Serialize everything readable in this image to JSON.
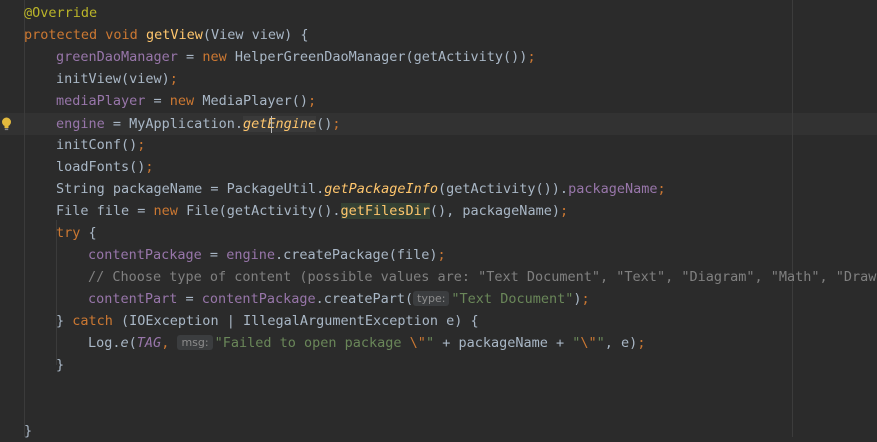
{
  "code": {
    "l1": {
      "annotation": "@Override"
    },
    "l2": {
      "kw1": "protected",
      "kw2": "void",
      "method": "getView",
      "params": "(View view) {"
    },
    "l3": {
      "field": "greenDaoManager",
      "eq": " = ",
      "kw": "new",
      "rest": " HelperGreenDaoManager(getActivity())",
      "semi": ";"
    },
    "l4": {
      "call": "initView(view)",
      "semi": ";"
    },
    "l5": {
      "field": "mediaPlayer",
      "eq": " = ",
      "kw": "new",
      "rest": " MediaPlayer()",
      "semi": ";"
    },
    "l6": {
      "field": "engine",
      "eq": " = MyApplication.",
      "static_call": "getEngine",
      "rest": "()",
      "semi": ";"
    },
    "l7": {
      "call": "initConf()",
      "semi": ";"
    },
    "l8": {
      "call": "loadFonts()",
      "semi": ";"
    },
    "l9": {
      "pre": "String packageName = PackageUtil.",
      "static_call": "getPackageInfo",
      "mid": "(getActivity()).",
      "field": "packageName",
      "semi": ";"
    },
    "l10": {
      "pre": "File file = ",
      "kw": "new",
      "mid": " File(getActivity().",
      "hl": "getFilesDir",
      "rest": "(), packageName)",
      "semi": ";"
    },
    "l11": {
      "kw": "try",
      "rest": " {"
    },
    "l12": {
      "field": "contentPackage",
      "eq": " = ",
      "field2": "engine",
      "rest": ".createPackage(file)",
      "semi": ";"
    },
    "l13": {
      "comment": "// Choose type of content (possible values are: \"Text Document\", \"Text\", \"Diagram\", \"Math\", \"Drawin"
    },
    "l14": {
      "field": "contentPart",
      "eq": " = ",
      "field2": "contentPackage",
      "rest": ".createPart(",
      "hint": "type:",
      "str": "\"Text Document\"",
      "close": ")",
      "semi": ";"
    },
    "l15": {
      "pre": "} ",
      "kw": "catch",
      "rest": " (IOException | IllegalArgumentException e) {"
    },
    "l16": {
      "pre": "Log.",
      "static_call": "e",
      "open": "(",
      "const": "TAG",
      "comma": ", ",
      "hint": "msg:",
      "str1": "\"Failed to open package ",
      "esc1": "\\\"",
      "str1end": "\"",
      "plus1": " + packageName + ",
      "str2": "\"",
      "esc2": "\\\"",
      "str2end": "\"",
      "end": ", e)",
      "semi": ";"
    },
    "l17": {
      "text": "}"
    },
    "l18": {
      "text": "}"
    }
  },
  "colors": {
    "background": "#2b2b2b",
    "keyword": "#cc7832",
    "method_decl": "#ffc66d",
    "field": "#9876aa",
    "string": "#6a8759",
    "comment": "#808080",
    "annotation": "#bbb529",
    "text": "#a9b7c6"
  },
  "icons": {
    "gutter": "lightbulb-icon"
  }
}
